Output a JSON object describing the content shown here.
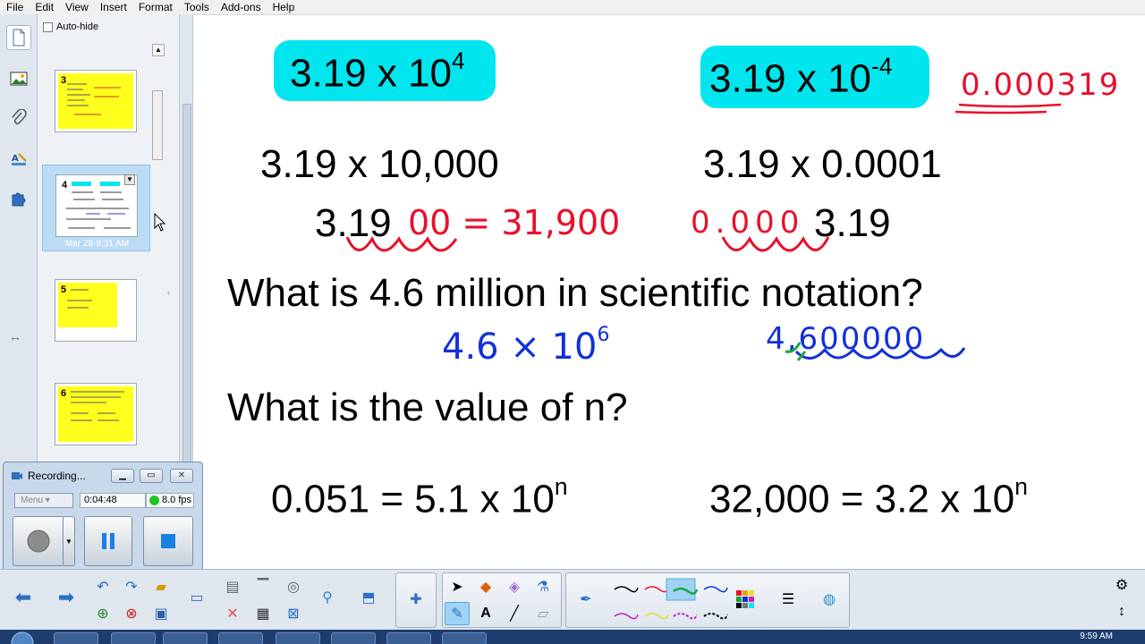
{
  "menu": [
    "File",
    "Edit",
    "View",
    "Insert",
    "Format",
    "Tools",
    "Add-ons",
    "Help"
  ],
  "sorter": {
    "autohide_label": "Auto-hide",
    "pages": [
      {
        "num": "3"
      },
      {
        "num": "4",
        "date": "Mar 28-9:31 AM",
        "selected": true
      },
      {
        "num": "5"
      },
      {
        "num": "6"
      }
    ]
  },
  "slide": {
    "top_left": {
      "base": "3.19 x 10",
      "exp": "4"
    },
    "top_right": {
      "base": "3.19 x 10",
      "exp": "-4"
    },
    "ink_top_right": "0.000319",
    "row2_left": "3.19 x 10,000",
    "row2_right": "3.19 x 0.0001",
    "row3_left_black": "3.19",
    "row3_left_ink": "00 = 31,900",
    "row3_right_ink": "0.000",
    "row3_right_black": "3.19",
    "question1": "What is 4.6 million in scientific notation?",
    "ink_answer1": {
      "base": "4.6 × 10",
      "exp": "6"
    },
    "ink_answer1_right": "4,600000",
    "question2": "What is the value of n?",
    "eq_left": {
      "base": "0.051 = 5.1 x 10",
      "exp": "n"
    },
    "eq_right": {
      "base": "32,000 = 3.2 x 10",
      "exp": "n"
    }
  },
  "recorder": {
    "title": "Recording...",
    "menu_label": "Menu",
    "elapsed": "0:04:48",
    "fps": "8.0 fps"
  },
  "taskbar": {
    "clock": "9:59 AM"
  },
  "colors": {
    "highlight": "#00e5ee",
    "ink_red": "#e8102a",
    "ink_blue": "#1230d8",
    "ink_green": "#1aa640",
    "thumb_yellow": "#ffff1e"
  }
}
